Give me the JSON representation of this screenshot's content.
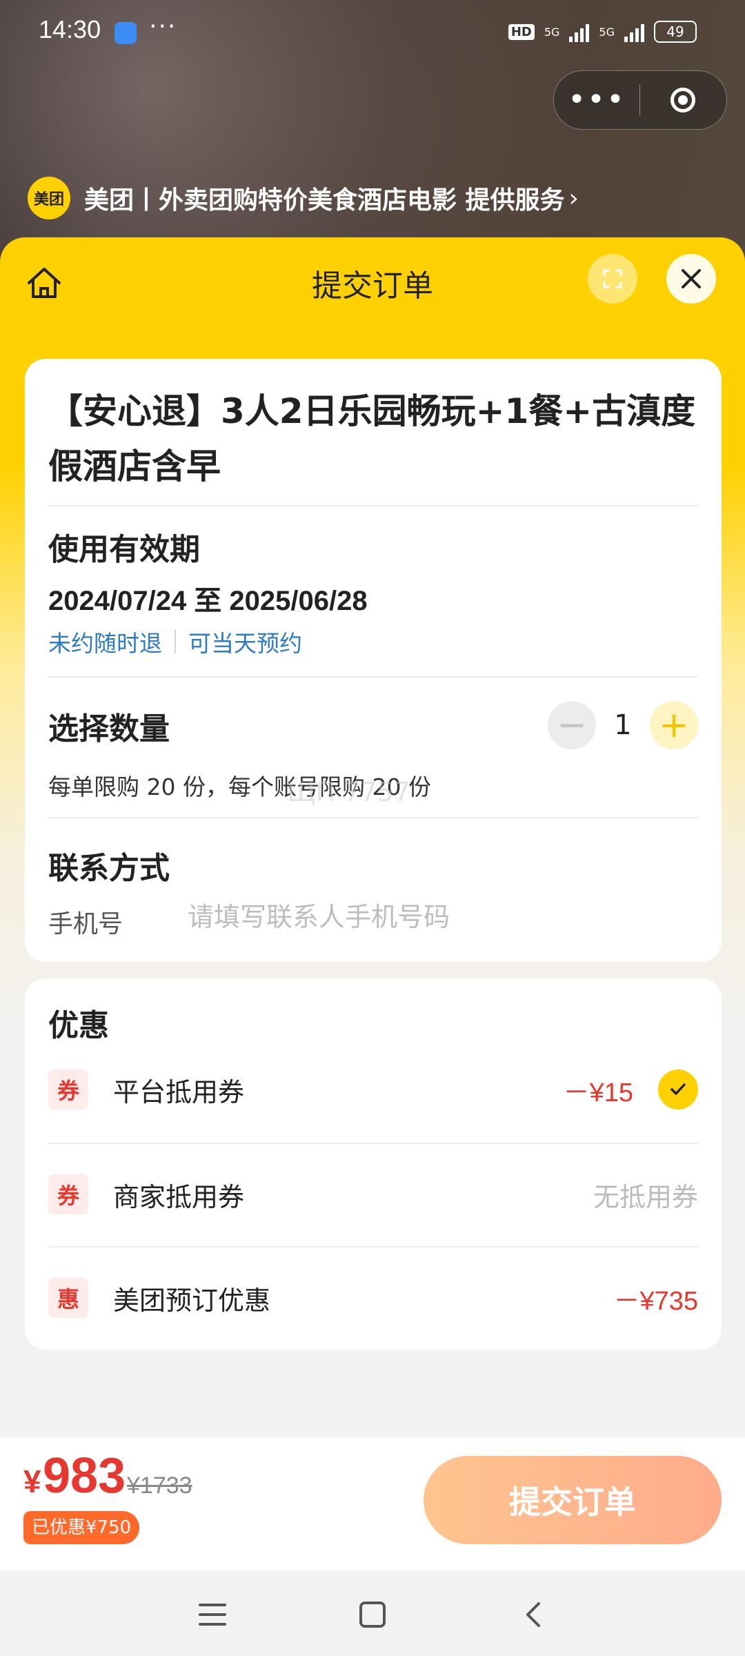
{
  "status_bar": {
    "time": "14:30",
    "dots": "···",
    "hd_tag": "HD",
    "battery": "49",
    "network_1": "5G",
    "network_2": "5G"
  },
  "capsule": {
    "more_icon": "more-dots-icon",
    "close_icon": "target-icon"
  },
  "provider": {
    "logo_text": "美团",
    "text": "美团丨外卖团购特价美食酒店电影 提供服务",
    "chevron": "›"
  },
  "nav": {
    "title": "提交订单"
  },
  "product": {
    "title": "【安心退】3人2日乐园畅玩+1餐+古滇度假酒店含早"
  },
  "validity": {
    "title": "使用有效期",
    "range": "2024/07/24 至 2025/06/28",
    "policy_1": "未约随时退",
    "policy_2": "可当天预约"
  },
  "quantity": {
    "title": "选择数量",
    "value": "1",
    "minus": "−",
    "plus": "+",
    "limit": "每单限购 20 份，每个账号限购 20 份",
    "watermark": "ЩП 7757"
  },
  "contact": {
    "title": "联系方式",
    "phone_label": "手机号",
    "phone_placeholder": "请填写联系人手机号码"
  },
  "discounts": {
    "title": "优惠",
    "rows": [
      {
        "tag": "券",
        "name": "平台抵用券",
        "value": "－¥15"
      },
      {
        "tag": "券",
        "name": "商家抵用券",
        "value": "无抵用券"
      },
      {
        "tag": "惠",
        "name": "美团预订优惠",
        "value": "－¥735"
      }
    ]
  },
  "checkout": {
    "currency": "¥",
    "price": "983",
    "original_price": "¥1733",
    "saved": "已优惠¥750",
    "submit_label": "提交订单"
  },
  "colors": {
    "brand_yellow": "#ffd100",
    "price_red": "#e8372e",
    "link_blue": "#2d7bc6"
  }
}
